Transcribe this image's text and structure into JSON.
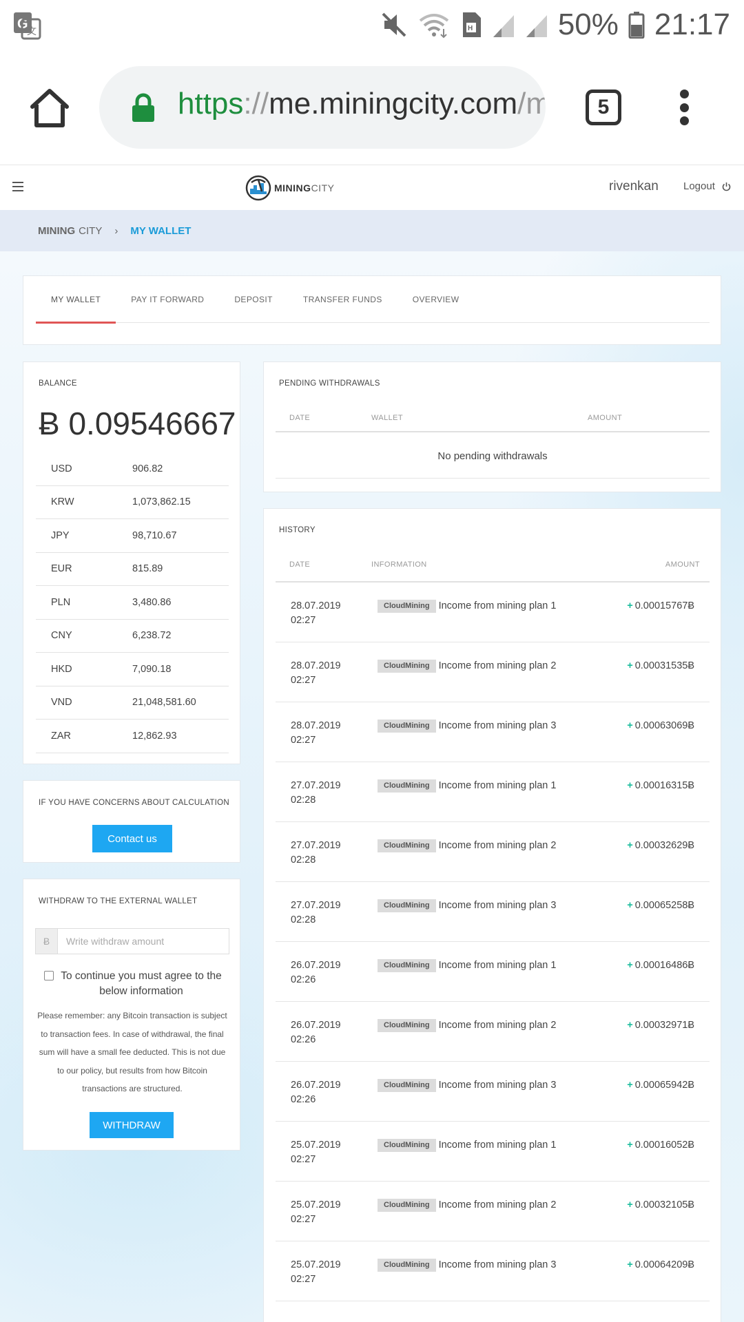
{
  "status_bar": {
    "battery": "50%",
    "time": "21:17"
  },
  "browser": {
    "url_scheme": "https",
    "url_sep": "://",
    "url_host": "me.miningcity.com",
    "url_path": "/my",
    "tab_count": "5"
  },
  "site_header": {
    "logo_bold": "MINING",
    "logo_light": "CITY",
    "username": "rivenkan",
    "logout_label": "Logout"
  },
  "breadcrumb": {
    "root_bold": "MINING",
    "root_light": "CITY",
    "separator": "›",
    "current": "MY WALLET"
  },
  "tabs": [
    "MY WALLET",
    "PAY IT FORWARD",
    "DEPOSIT",
    "TRANSFER FUNDS",
    "OVERVIEW"
  ],
  "balance": {
    "title": "BALANCE",
    "amount": "Ƀ 0.09546667",
    "currencies": [
      {
        "code": "USD",
        "value": "906.82"
      },
      {
        "code": "KRW",
        "value": "1,073,862.15"
      },
      {
        "code": "JPY",
        "value": "98,710.67"
      },
      {
        "code": "EUR",
        "value": "815.89"
      },
      {
        "code": "PLN",
        "value": "3,480.86"
      },
      {
        "code": "CNY",
        "value": "6,238.72"
      },
      {
        "code": "HKD",
        "value": "7,090.18"
      },
      {
        "code": "VND",
        "value": "21,048,581.60"
      },
      {
        "code": "ZAR",
        "value": "12,862.93"
      }
    ]
  },
  "concerns": {
    "title": "IF YOU HAVE CONCERNS ABOUT CALCULATION",
    "button": "Contact us"
  },
  "withdraw": {
    "title": "WITHDRAW TO THE EXTERNAL WALLET",
    "addon": "Ƀ",
    "placeholder": "Write withdraw amount",
    "agree_text": "To continue you must agree to the below information",
    "notice": "Please remember: any Bitcoin transaction is subject to transaction fees. In case of withdrawal, the final sum will have a small fee deducted. This is not due to our policy, but results from how Bitcoin transactions are structured.",
    "button": "WITHDRAW"
  },
  "pending": {
    "title": "PENDING WITHDRAWALS",
    "col_date": "DATE",
    "col_wallet": "WALLET",
    "col_amount": "AMOUNT",
    "empty": "No pending withdrawals"
  },
  "history": {
    "title": "HISTORY",
    "col_date": "DATE",
    "col_info": "INFORMATION",
    "col_amount": "AMOUNT",
    "rows": [
      {
        "date": "28.07.2019",
        "time": "02:27",
        "tag": "CloudMining",
        "info": "Income from mining plan 1",
        "sign": "+",
        "amount": "0.00015767Ƀ"
      },
      {
        "date": "28.07.2019",
        "time": "02:27",
        "tag": "CloudMining",
        "info": "Income from mining plan 2",
        "sign": "+",
        "amount": "0.00031535Ƀ"
      },
      {
        "date": "28.07.2019",
        "time": "02:27",
        "tag": "CloudMining",
        "info": "Income from mining plan 3",
        "sign": "+",
        "amount": "0.00063069Ƀ"
      },
      {
        "date": "27.07.2019",
        "time": "02:28",
        "tag": "CloudMining",
        "info": "Income from mining plan 1",
        "sign": "+",
        "amount": "0.00016315Ƀ"
      },
      {
        "date": "27.07.2019",
        "time": "02:28",
        "tag": "CloudMining",
        "info": "Income from mining plan 2",
        "sign": "+",
        "amount": "0.00032629Ƀ"
      },
      {
        "date": "27.07.2019",
        "time": "02:28",
        "tag": "CloudMining",
        "info": "Income from mining plan 3",
        "sign": "+",
        "amount": "0.00065258Ƀ"
      },
      {
        "date": "26.07.2019",
        "time": "02:26",
        "tag": "CloudMining",
        "info": "Income from mining plan 1",
        "sign": "+",
        "amount": "0.00016486Ƀ"
      },
      {
        "date": "26.07.2019",
        "time": "02:26",
        "tag": "CloudMining",
        "info": "Income from mining plan 2",
        "sign": "+",
        "amount": "0.00032971Ƀ"
      },
      {
        "date": "26.07.2019",
        "time": "02:26",
        "tag": "CloudMining",
        "info": "Income from mining plan 3",
        "sign": "+",
        "amount": "0.00065942Ƀ"
      },
      {
        "date": "25.07.2019",
        "time": "02:27",
        "tag": "CloudMining",
        "info": "Income from mining plan 1",
        "sign": "+",
        "amount": "0.00016052Ƀ"
      },
      {
        "date": "25.07.2019",
        "time": "02:27",
        "tag": "CloudMining",
        "info": "Income from mining plan 2",
        "sign": "+",
        "amount": "0.00032105Ƀ"
      },
      {
        "date": "25.07.2019",
        "time": "02:27",
        "tag": "CloudMining",
        "info": "Income from mining plan 3",
        "sign": "+",
        "amount": "0.00064209Ƀ"
      }
    ]
  },
  "colors": {
    "accent_blue": "#1ea7f2",
    "tab_active_underline": "#e05555",
    "positive_green": "#1abc9c",
    "breadcrumb_bg": "#e3eaf5"
  }
}
